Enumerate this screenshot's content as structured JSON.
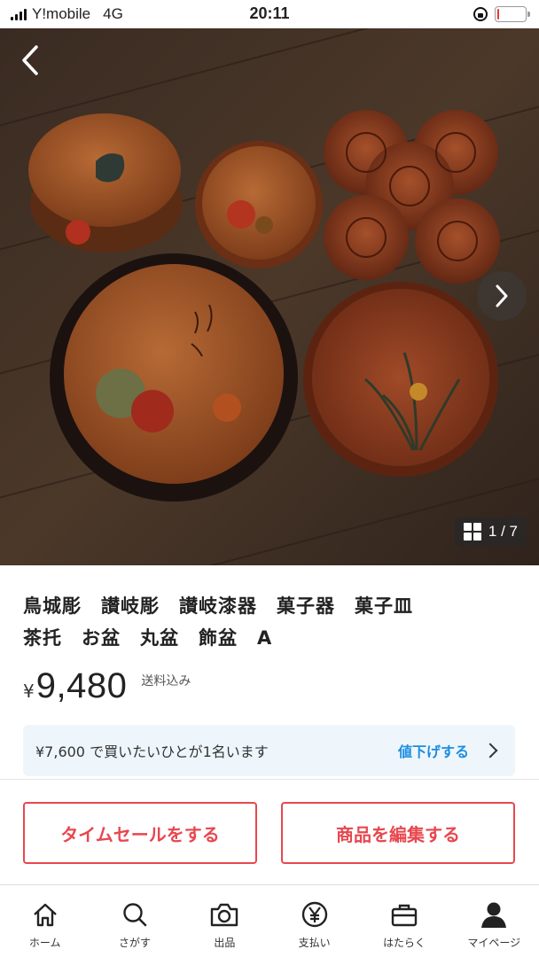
{
  "status_bar": {
    "carrier": "Y!mobile",
    "network": "4G",
    "time": "20:11",
    "battery_level": 0.08,
    "battery_color": "#e53935"
  },
  "photo": {
    "back_icon": "chevron-left-icon",
    "next_icon": "chevron-right-icon",
    "counter": "1 / 7"
  },
  "item": {
    "title": "鳥城彫　讃岐彫　讃岐漆器　菓子器　菓子皿\n茶托　お盆　丸盆　飾盆　A",
    "currency_symbol": "¥",
    "price": "9,480",
    "shipping_note": "送料込み"
  },
  "offer": {
    "text": "¥7,600 で買いたいひとが1名います",
    "link": "値下げする"
  },
  "actions": {
    "time_sale": "タイムセールをする",
    "edit": "商品を編集する",
    "accent_color": "#e8474f"
  },
  "tabbar": {
    "items": [
      {
        "label": "ホーム",
        "icon": "home-icon"
      },
      {
        "label": "さがす",
        "icon": "search-icon"
      },
      {
        "label": "出品",
        "icon": "camera-icon"
      },
      {
        "label": "支払い",
        "icon": "yen-icon"
      },
      {
        "label": "はたらく",
        "icon": "briefcase-icon"
      },
      {
        "label": "マイページ",
        "icon": "user-icon"
      }
    ]
  }
}
